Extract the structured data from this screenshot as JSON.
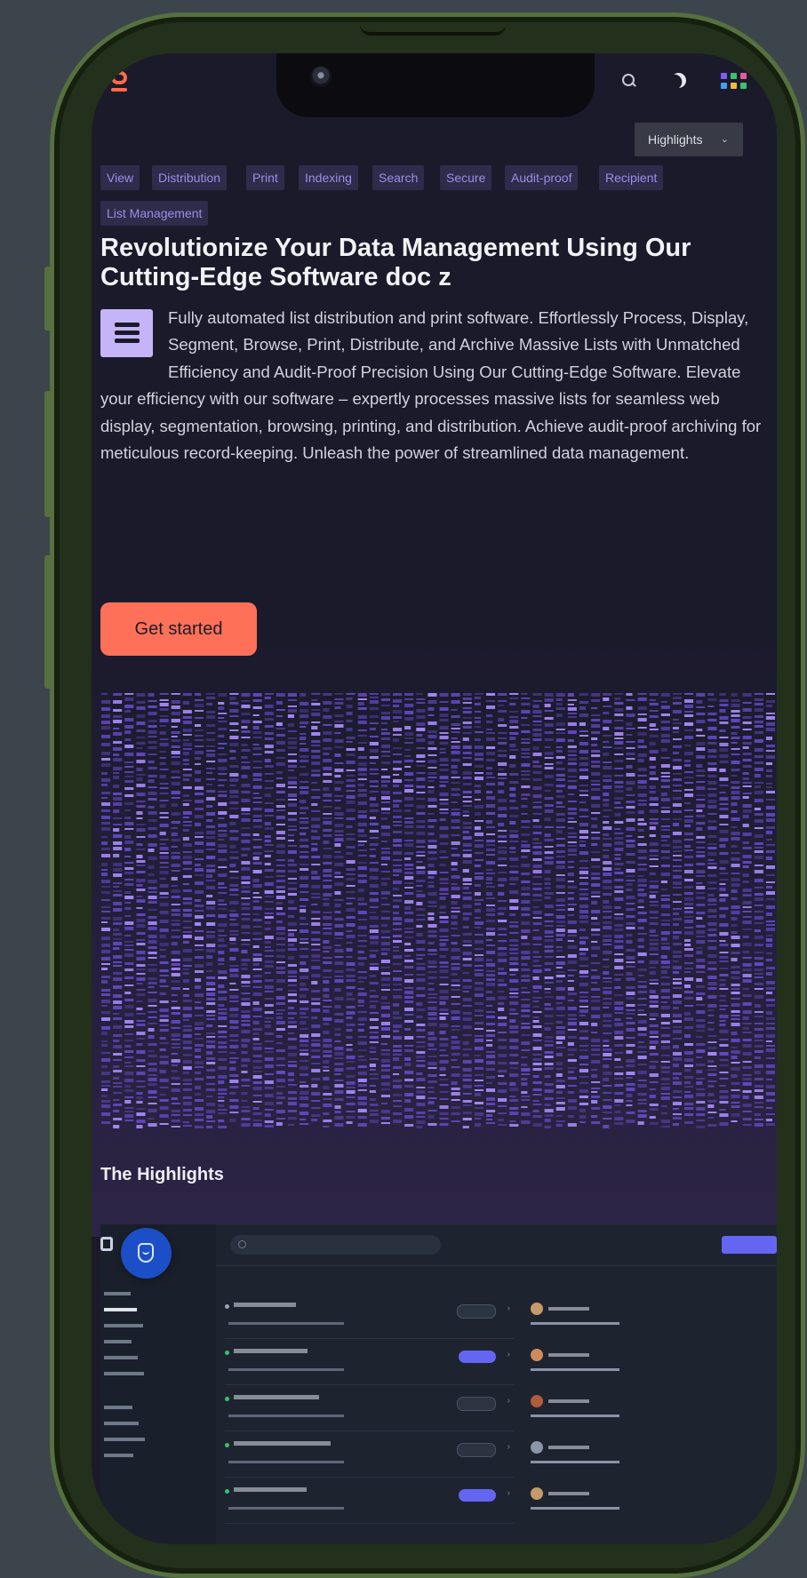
{
  "topbar": {
    "search_icon": "search-icon",
    "theme_icon": "moon-icon",
    "apps_icon": "app-grid-icon",
    "apps_colors": [
      "#7b5cf6",
      "#39c46a",
      "#f5b93f",
      "#e75a9b",
      "#3fa0f5",
      "#7b5cf6"
    ]
  },
  "nav": {
    "select_label": "Highlights"
  },
  "tags": [
    "View",
    "Distribution",
    "Print",
    "Indexing",
    "Search",
    "Secure",
    "Audit-proof",
    "Recipient",
    "List Management"
  ],
  "hero": {
    "title": "Revolutionize Your Data Management Using Our Cutting-Edge Software doc z",
    "description": "Fully automated list distribution and print software. Effortlessly Process, Display, Segment, Browse, Print, Distribute, and Archive Massive Lists with Unmatched Efficiency and Audit-Proof Precision Using Our Cutting-Edge Software. Elevate your efficiency with our software – expertly processes massive lists for seamless web display, segmentation, browsing, printing, and distribution. Achieve audit-proof archiving for meticulous record-keeping. Unleash the power of streamlined data management.",
    "cta_label": "Get started"
  },
  "colors": {
    "accent": "#ff7058",
    "brand": "#ff6b48",
    "tag_text": "#9d8ce8",
    "icon_bg": "#c6b4f8",
    "pattern": "#7c5ce8"
  },
  "highlights": {
    "title": "The Highlights"
  }
}
